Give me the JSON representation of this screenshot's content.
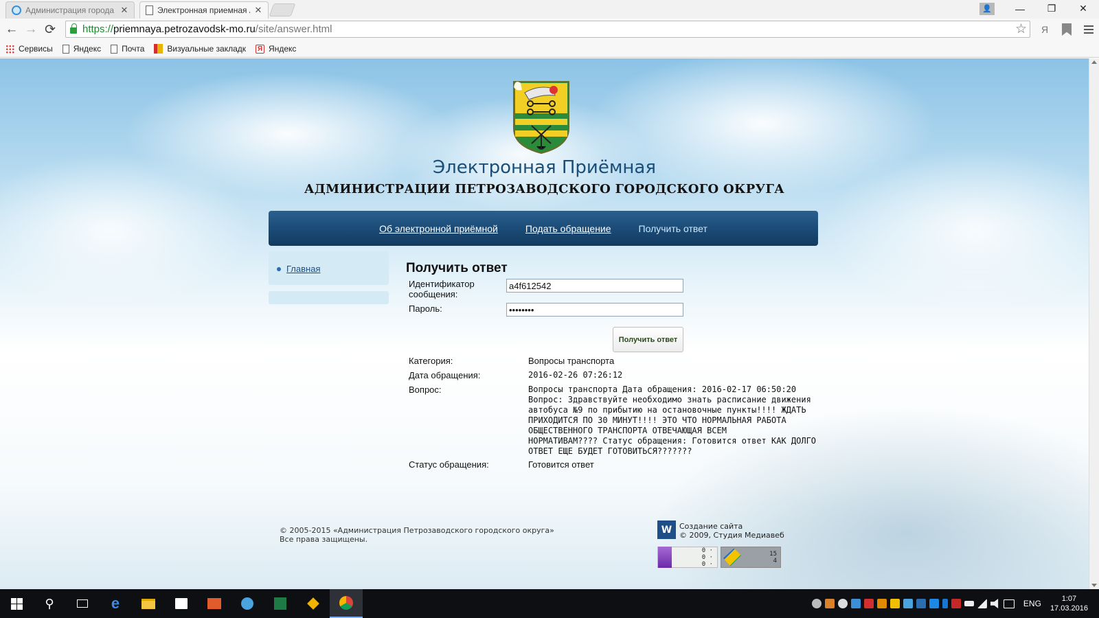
{
  "browser": {
    "tabs": [
      {
        "title": "Администрация города П",
        "favicon": "globe-icon",
        "active": false
      },
      {
        "title": "Электронная приемная А",
        "favicon": "page-icon",
        "active": true
      }
    ],
    "close_glyph": "✕",
    "window_controls": {
      "minimize": "—",
      "maximize": "❐",
      "close": "✕"
    },
    "profile_glyph": "👤",
    "url": {
      "scheme": "https://",
      "host": "priemnaya.petrozavodsk-mo.ru",
      "path": "/site/answer.html"
    },
    "nav": {
      "back": "←",
      "forward": "→",
      "reload": "⟳"
    },
    "star_glyph": "☆",
    "yandex_ext_glyph": "Я",
    "bookmarks": [
      {
        "label": "Сервисы",
        "icon": "apps-icon"
      },
      {
        "label": "Яндекс",
        "icon": "page-icon"
      },
      {
        "label": "Почта",
        "icon": "page-icon"
      },
      {
        "label": "Визуальные закладк",
        "icon": "visual-bookmarks-icon"
      },
      {
        "label": "Яндекс",
        "icon": "yandex-icon"
      }
    ],
    "bookmark_ya_glyph": "Я"
  },
  "header": {
    "title": "Электронная Приёмная",
    "subtitle": "АДМИНИСТРАЦИИ ПЕТРОЗАВОДСКОГО ГОРОДСКОГО ОКРУГА"
  },
  "nav": {
    "items": [
      {
        "label": "Об электронной приёмной",
        "current": false
      },
      {
        "label": "Подать обращение",
        "current": false
      },
      {
        "label": "Получить ответ",
        "current": true
      }
    ]
  },
  "sidebar": {
    "items": [
      {
        "label": "Главная"
      }
    ]
  },
  "main": {
    "heading": "Получить ответ",
    "form": {
      "id_label": "Идентификатор сообщения:",
      "id_value": "a4f612542",
      "password_label": "Пароль:",
      "password_value": "********",
      "submit_label": "Получить ответ"
    },
    "result": {
      "category_label": "Категория:",
      "category_value": "Вопросы транспорта",
      "date_label": "Дата обращения:",
      "date_value": "2016-02-26 07:26:12",
      "question_label": "Вопрос:",
      "question_value": "Вопросы транспорта Дата обращения: 2016-02-17 06:50:20\nВопрос: Здравствуйте необходимо знать расписание движения\nавтобуса №9 по прибытию на остановочные пункты!!!! ЖДАТЬ\nПРИХОДИТСЯ ПО 30 МИНУТ!!!! ЭТО ЧТО НОРМАЛЬНАЯ РАБОТА\nОБЩЕСТВЕННОГО ТРАНСПОРТА ОТВЕЧАЮЩАЯ ВСЕМ\nНОРМАТИВАМ???? Статус обращения: Готовится ответ КАК ДОЛГО\nОТВЕТ ЕЩЕ БУДЕТ ГОТОВИТЬСЯ???????",
      "status_label": "Статус обращения:",
      "status_value": "Готовится ответ"
    }
  },
  "footer": {
    "copyright_line1": "© 2005-2015 «Администрация Петрозаводского городского округа»",
    "copyright_line2": "Все права защищены.",
    "studio_logo": "W",
    "studio_line1": "Создание сайта",
    "studio_line2": "© 2009, Студия Медиавеб",
    "counter1_digits": "0 ·\n0 ·\n0 ·",
    "counter2_digits": "15\n4"
  },
  "taskbar": {
    "lang": "ENG",
    "time": "1:07",
    "date": "17.03.2016",
    "search_glyph": "⚲",
    "edge_glyph": "e"
  },
  "colors": {
    "accent_nav": "#1a4a75",
    "title": "#1b4f78",
    "sidebar_bg": "#d4eaf5",
    "url_secure": "#1e8a2e"
  }
}
